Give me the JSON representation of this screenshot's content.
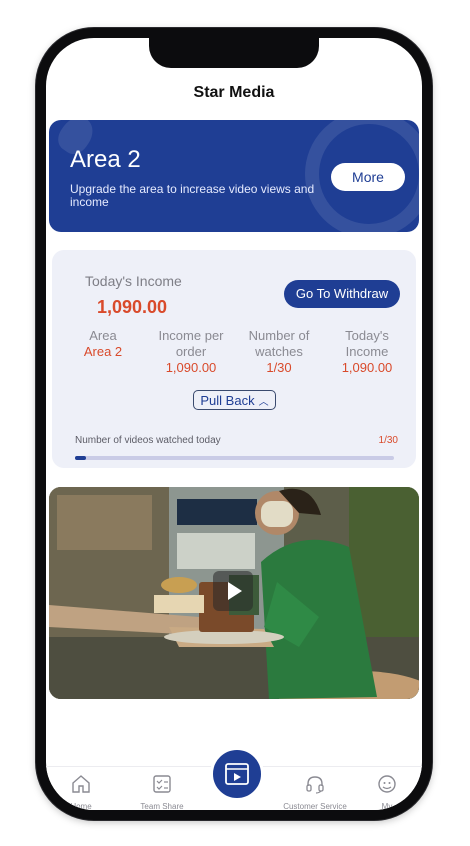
{
  "app": {
    "title": "Star Media"
  },
  "area_banner": {
    "title": "Area 2",
    "description": "Upgrade the area to increase video views and income",
    "more_label": "More"
  },
  "income_card": {
    "todays_income_label": "Today's Income",
    "todays_income_value": "1,090.00",
    "withdraw_label": "Go To Withdraw",
    "stats": [
      {
        "header": "Area",
        "value": "Area 2"
      },
      {
        "header": "Income per order",
        "value": "1,090.00"
      },
      {
        "header": "Number of watches",
        "value": "1/30"
      },
      {
        "header": "Today's Income",
        "value": "1,090.00"
      }
    ],
    "pull_back_label": "Pull Back",
    "videos_watched_label": "Number of videos watched today",
    "videos_watched_count": "1/30",
    "videos_watched_progress": 0.033
  },
  "video": {
    "play_icon": "play-icon"
  },
  "tabbar": {
    "items": [
      {
        "label": "Home",
        "icon": "home-icon"
      },
      {
        "label": "Team Share",
        "icon": "team-share-icon"
      },
      {
        "label": "",
        "icon": "video-icon"
      },
      {
        "label": "Customer Service",
        "icon": "headset-icon"
      },
      {
        "label": "My",
        "icon": "profile-icon"
      }
    ]
  },
  "colors": {
    "primary": "#1f3e94",
    "accent_red": "#d94a2b",
    "card_bg": "#eef0f8"
  }
}
